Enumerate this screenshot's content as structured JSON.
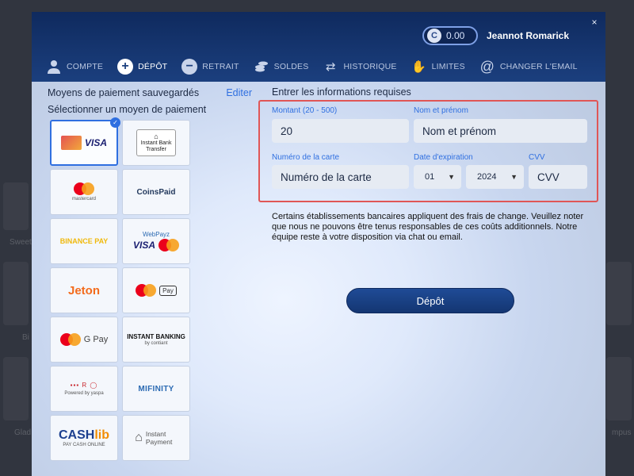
{
  "header": {
    "balance": "0.00",
    "coin_symbol": "C",
    "user_name": "Jeannot Romarick",
    "close_symbol": "×"
  },
  "tabs": [
    {
      "label": "COMPTE",
      "icon": "user-icon",
      "active": false
    },
    {
      "label": "DÉPÔT",
      "icon": "plus-circle-icon",
      "active": true
    },
    {
      "label": "RETRAIT",
      "icon": "minus-circle-icon",
      "active": false
    },
    {
      "label": "SOLDES",
      "icon": "coins-icon",
      "active": false
    },
    {
      "label": "HISTORIQUE",
      "icon": "arrows-icon",
      "active": false
    },
    {
      "label": "LIMITES",
      "icon": "hand-icon",
      "active": false
    },
    {
      "label": "CHANGER L'EMAIL",
      "icon": "at-icon",
      "active": false
    }
  ],
  "left": {
    "saved_methods_label": "Moyens de paiement sauvegardés",
    "edit_label": "Editer",
    "select_method_label": "Sélectionner un moyen de paiement"
  },
  "payment_methods": [
    {
      "name": "Visa card",
      "text": "VISA",
      "selected": true
    },
    {
      "name": "Instant Bank Transfer",
      "text": "Instant Bank Transfer"
    },
    {
      "name": "Mastercard",
      "text": "mastercard"
    },
    {
      "name": "CoinsPaid",
      "text": "CoinsPaid"
    },
    {
      "name": "Binance Pay",
      "text": "BINANCE PAY"
    },
    {
      "name": "WebPayz Visa Mastercard",
      "text": "WebPayz"
    },
    {
      "name": "Jeton",
      "text": "Jeton"
    },
    {
      "name": "Mastercard Apple Pay",
      "text": "Pay"
    },
    {
      "name": "Mastercard Google Pay",
      "text": "G Pay"
    },
    {
      "name": "Instant Banking by Contiant",
      "text": "INSTANT BANKING",
      "sub": "by contiant"
    },
    {
      "name": "Yaspa",
      "text": "Powered by yaspa"
    },
    {
      "name": "MiFinity",
      "text": "MIFINITY"
    },
    {
      "name": "CASHlib",
      "text": "CASH",
      "text2": "lib",
      "sub": "PAY CASH ONLINE"
    },
    {
      "name": "Instant Payment",
      "text": "Instant Payment"
    }
  ],
  "form": {
    "title": "Entrer les informations requises",
    "amount_label": "Montant (20 - 500)",
    "amount_value": "20",
    "name_label": "Nom et prénom",
    "name_placeholder": "Nom et prénom",
    "card_label": "Numéro de la carte",
    "card_placeholder": "Numéro de la carte",
    "expiry_label": "Date d'expiration",
    "expiry_month": "01",
    "expiry_year": "2024",
    "cvv_label": "CVV",
    "cvv_placeholder": "CVV"
  },
  "notice": "Certains établissements bancaires appliquent des frais de change. Veuillez noter que nous ne pouvons être tenus responsables de ces coûts additionnels. Notre équipe reste à votre disposition via chat ou email.",
  "deposit_button": "Dépôt",
  "colors": {
    "header_bg": "#0f2a5e",
    "accent": "#2f6fe0",
    "highlight_border": "#e05656",
    "button_bg": "#1f4b96"
  },
  "background": {
    "labels": [
      "Sweet",
      "Bi",
      "Glad",
      "mpus"
    ]
  }
}
